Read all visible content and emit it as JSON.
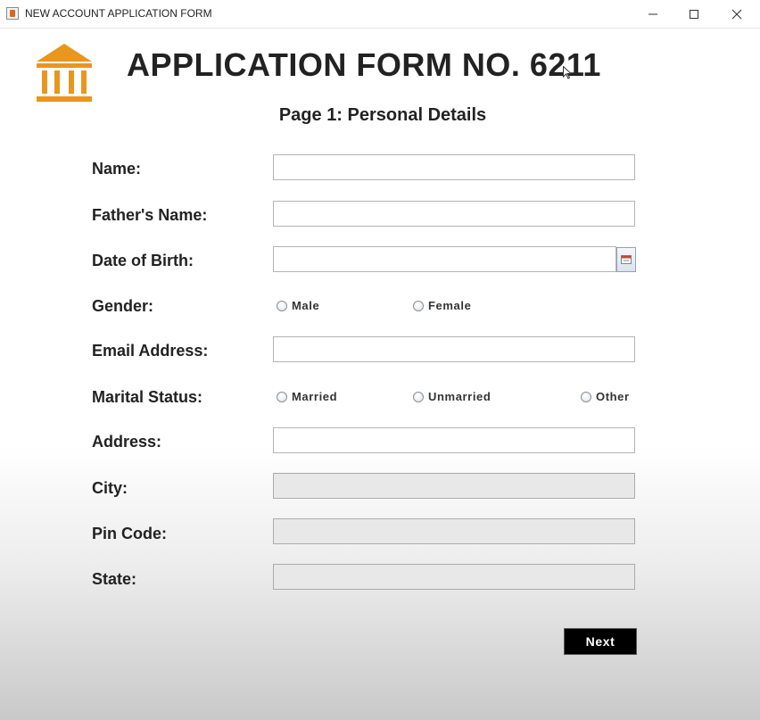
{
  "window": {
    "title": "NEW ACCOUNT APPLICATION FORM",
    "controls": {
      "minimize": "—",
      "maximize": "☐",
      "close": "✕"
    }
  },
  "header": {
    "logo_icon": "bank-building-icon",
    "logo_color": "#E8961E",
    "title": "APPLICATION FORM NO. 6211",
    "subtitle": "Page 1: Personal Details"
  },
  "fields": {
    "name": {
      "label": "Name:",
      "value": ""
    },
    "father_name": {
      "label": "Father's Name:",
      "value": ""
    },
    "dob": {
      "label": "Date of Birth:",
      "value": "",
      "picker_icon": "calendar-icon"
    },
    "gender": {
      "label": "Gender:",
      "options": [
        "Male",
        "Female"
      ],
      "selected": null
    },
    "email": {
      "label": "Email Address:",
      "value": ""
    },
    "marital_status": {
      "label": "Marital Status:",
      "options": [
        "Married",
        "Unmarried",
        "Other"
      ],
      "selected": null
    },
    "address": {
      "label": "Address:",
      "value": ""
    },
    "city": {
      "label": "City:",
      "value": ""
    },
    "pin_code": {
      "label": "Pin Code:",
      "value": ""
    },
    "state": {
      "label": "State:",
      "value": ""
    }
  },
  "actions": {
    "next_label": "Next"
  }
}
